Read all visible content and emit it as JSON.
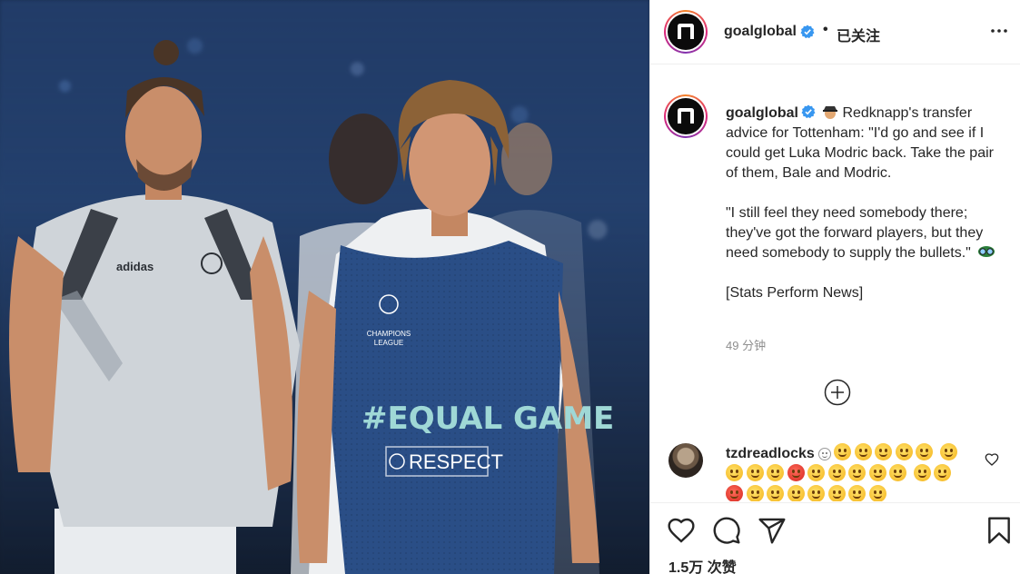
{
  "photo": {
    "jersey_text_main": "#EQUAL GAME",
    "jersey_text_respect": "RESPECT",
    "jersey_badge_line1": "CHAMPIONS",
    "jersey_badge_line2": "LEAGUE",
    "brand_text": "adidas"
  },
  "header": {
    "username": "goalglobal",
    "separator": "•",
    "follow_status": "已关注"
  },
  "post": {
    "username": "goalglobal",
    "caption_line1": "Redknapp's transfer advice for Tottenham: \"I'd go and see if I could get Luka Modric back. Take the pair of them, Bale and Modric.",
    "caption_line2": "\"I still feel they need somebody there; they've got the forward players, but they need somebody to supply the bullets.\"",
    "caption_line3": "[Stats Perform News]",
    "time_ago": "49 分钟"
  },
  "comment": {
    "username": "tzdreadlocks"
  },
  "footer": {
    "likes": "1.5万 次赞"
  },
  "colors": {
    "verified": "#3897f0",
    "text": "#262626",
    "muted": "#8e8e8e",
    "border": "#efefef"
  },
  "icons": [
    "verified-badge-icon",
    "more-options-icon",
    "detective-emoji-icon",
    "goggles-emoji-icon",
    "load-more-plus-icon",
    "heart-icon",
    "comment-icon",
    "share-icon",
    "bookmark-icon",
    "small-heart-icon"
  ]
}
